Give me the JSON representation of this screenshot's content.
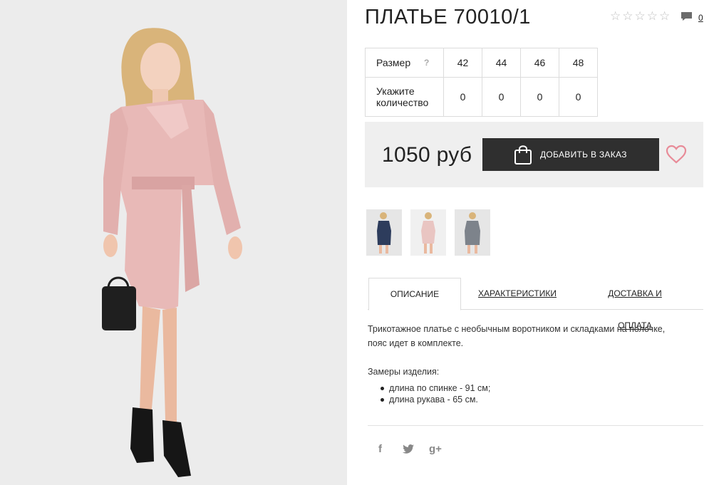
{
  "product": {
    "title": "ПЛАТЬЕ 70010/1",
    "rating_stars": [
      "☆",
      "☆",
      "☆",
      "☆",
      "☆"
    ],
    "comments_count": "0"
  },
  "sizes": {
    "size_label": "Размер",
    "help_label": "?",
    "qty_label_line1": "Укажите",
    "qty_label_line2": "количество",
    "values": [
      "42",
      "44",
      "46",
      "48"
    ],
    "quantities": [
      "0",
      "0",
      "0",
      "0"
    ]
  },
  "purchase": {
    "price": "1050 руб",
    "add_button": "ДОБАВИТЬ В ЗАКАЗ"
  },
  "colors": {
    "dress_main": "#e8b9b7",
    "dress_shadow": "#d9a3a2",
    "button_bg": "#2f2f2f",
    "heart": "#e88b98",
    "thumb_navy": "#2d3c5c",
    "thumb_pink": "#e9c5c2",
    "thumb_gray": "#7d838b"
  },
  "thumbnails": [
    {
      "name": "navy-dress-thumbnail"
    },
    {
      "name": "pink-dress-thumbnail"
    },
    {
      "name": "gray-dress-thumbnail"
    }
  ],
  "tabs": {
    "description": "ОПИСАНИЕ",
    "specs": "ХАРАКТЕРИСТИКИ",
    "delivery": "ДОСТАВКА И ОПЛАТА"
  },
  "description": {
    "text_line1": "Трикотажное платье с необычным воротником и складками на полочке,",
    "text_line2": "пояс идет в комплекте.",
    "measures_title": "Замеры изделия:",
    "measures": [
      "длина по спинке - 91 см;",
      "длина рукава - 65 см."
    ]
  },
  "social": {
    "facebook": "f",
    "twitter": "🐦",
    "google": "g+"
  }
}
